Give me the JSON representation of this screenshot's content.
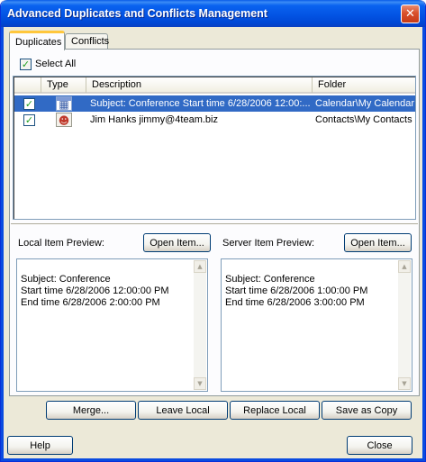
{
  "window": {
    "title": "Advanced Duplicates and Conflicts Management"
  },
  "title_bar": {
    "close_glyph": "✕"
  },
  "tabs": [
    {
      "label": "Duplicates",
      "active": true
    },
    {
      "label": "Conflicts",
      "active": false
    }
  ],
  "select_all": {
    "label": "Select All",
    "checked": true
  },
  "list": {
    "columns": [
      "Type",
      "Description",
      "Folder"
    ],
    "rows": [
      {
        "checked": true,
        "type_icon": "calendar-icon",
        "description": "Subject: Conference Start time 6/28/2006 12:00:...",
        "folder": "Calendar\\My Calendar",
        "selected": true
      },
      {
        "checked": true,
        "type_icon": "contact-icon",
        "description": "Jim Hanks jimmy@4team.biz",
        "folder": "Contacts\\My Contacts",
        "selected": false
      }
    ]
  },
  "local_preview": {
    "label": "Local Item Preview:",
    "open_button": "Open Item...",
    "content": "Subject: Conference\nStart time 6/28/2006 12:00:00 PM\nEnd time 6/28/2006 2:00:00 PM"
  },
  "server_preview": {
    "label": "Server Item Preview:",
    "open_button": "Open Item...",
    "content": "Subject: Conference\nStart time 6/28/2006 1:00:00 PM\nEnd time 6/28/2006 3:00:00 PM"
  },
  "actions": {
    "merge": "Merge...",
    "leave_local": "Leave Local",
    "replace_local": "Replace Local",
    "save_as_copy": "Save as Copy"
  },
  "footer": {
    "help": "Help",
    "close": "Close"
  },
  "colors": {
    "titlebar": "#0252e2",
    "dialog_bg": "#ece9d8",
    "selection": "#316ac5",
    "tab_highlight": "#ffc73c"
  }
}
